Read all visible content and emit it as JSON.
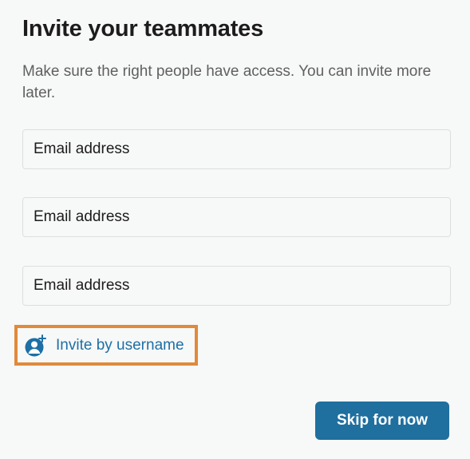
{
  "dialog": {
    "title": "Invite your teammates",
    "subtitle": "Make sure the right people have access. You can invite more later."
  },
  "email_fields": [
    {
      "placeholder": "Email address",
      "value": ""
    },
    {
      "placeholder": "Email address",
      "value": ""
    },
    {
      "placeholder": "Email address",
      "value": ""
    }
  ],
  "invite_by_username": {
    "label": "Invite by username",
    "icon": "add-user-icon",
    "highlight_color": "#e08a3a"
  },
  "skip_button": {
    "label": "Skip for now"
  },
  "colors": {
    "background": "#f7f8f8",
    "link": "#1d6fa5",
    "primary_button": "#1f6f9f",
    "text": "#1d1c1d",
    "muted_text": "#616061"
  }
}
